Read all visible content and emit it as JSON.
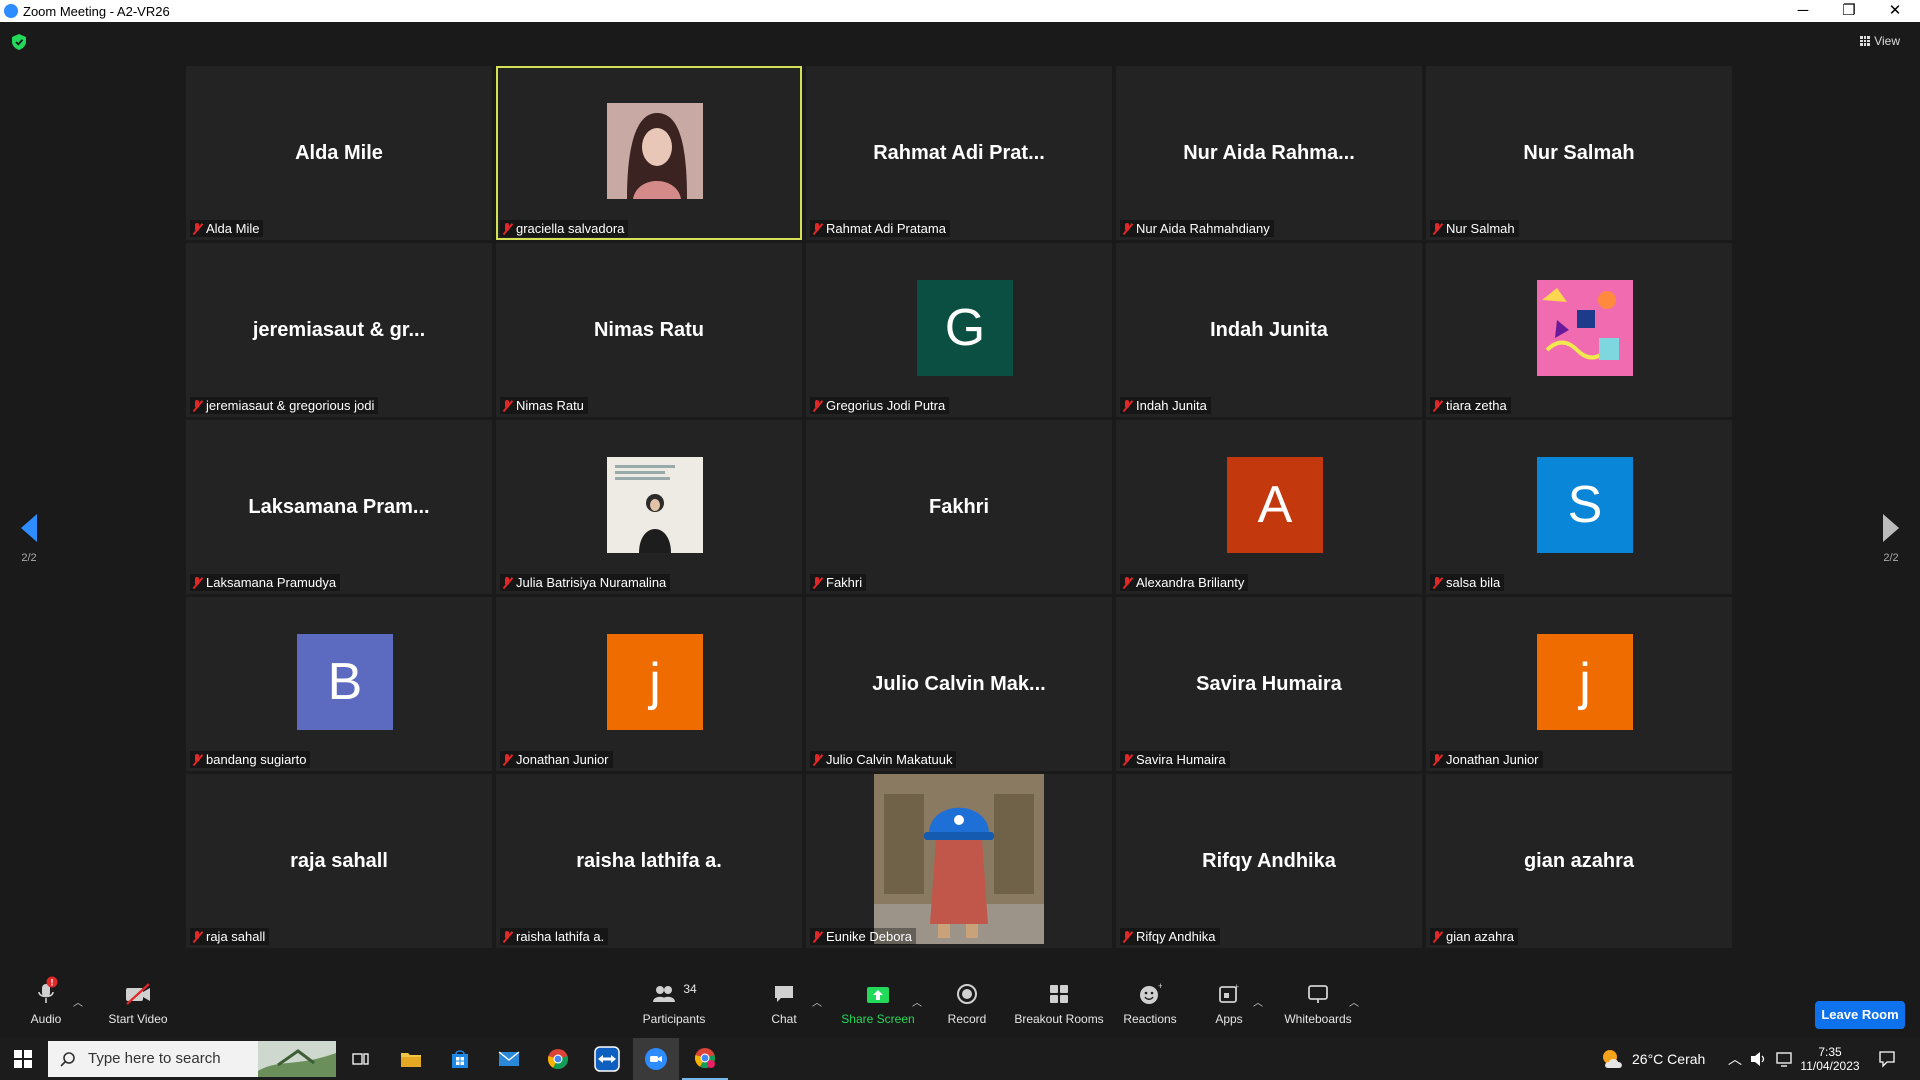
{
  "window": {
    "title": "Zoom Meeting - A2-VR26",
    "minimize": "─",
    "maximize": "❐",
    "close": "✕"
  },
  "view_label": "View",
  "pager": {
    "left": "2/2",
    "right": "2/2"
  },
  "tiles": [
    {
      "big": "Alda Mile",
      "label": "Alda Mile"
    },
    {
      "big": "",
      "label": "graciella salvadora",
      "photo": "portrait"
    },
    {
      "big": "Rahmat Adi Prat...",
      "label": "Rahmat Adi Pratama"
    },
    {
      "big": "Nur Aida Rahma...",
      "label": "Nur Aida Rahmahdiany"
    },
    {
      "big": "Nur Salmah",
      "label": "Nur Salmah"
    },
    {
      "big": "jeremiasaut & gr...",
      "label": "jeremiasaut & gregorious jodi"
    },
    {
      "big": "Nimas Ratu",
      "label": "Nimas Ratu"
    },
    {
      "big": "",
      "label": "Gregorius Jodi Putra",
      "letter": "G",
      "color": "#0b4f43"
    },
    {
      "big": "Indah Junita",
      "label": "Indah Junita"
    },
    {
      "big": "",
      "label": "tiara zetha",
      "photo": "pattern"
    },
    {
      "big": "Laksamana Pram...",
      "label": "Laksamana Pramudya"
    },
    {
      "big": "",
      "label": "Julia Batrisiya Nuramalina",
      "photo": "poster"
    },
    {
      "big": "Fakhri",
      "label": "Fakhri"
    },
    {
      "big": "",
      "label": "Alexandra Brilianty",
      "letter": "A",
      "color": "#c4380d"
    },
    {
      "big": "",
      "label": "salsa bila",
      "letter": "S",
      "color": "#0a86d9"
    },
    {
      "big": "",
      "label": "bandang sugiarto",
      "letter": "B",
      "color": "#5c6bc0"
    },
    {
      "big": "",
      "label": "Jonathan Junior",
      "letter": "j",
      "color": "#ef6c00"
    },
    {
      "big": "Julio Calvin Mak...",
      "label": "Julio Calvin Makatuuk"
    },
    {
      "big": "Savira Humaira",
      "label": "Savira Humaira"
    },
    {
      "big": "",
      "label": "Jonathan Junior",
      "letter": "j",
      "color": "#ef6c00"
    },
    {
      "big": "raja sahall",
      "label": "raja sahall"
    },
    {
      "big": "raisha lathifa a.",
      "label": "raisha lathifa a."
    },
    {
      "big": "",
      "label": "Eunike Debora",
      "photo": "character"
    },
    {
      "big": "Rifqy Andhika",
      "label": "Rifqy Andhika"
    },
    {
      "big": "gian azahra",
      "label": "gian azahra"
    }
  ],
  "toolbar": {
    "audio": "Audio",
    "audio_badge": "!",
    "start_video": "Start Video",
    "participants": "Participants",
    "participants_count": "34",
    "chat": "Chat",
    "share_screen": "Share Screen",
    "record": "Record",
    "breakout_rooms": "Breakout Rooms",
    "reactions": "Reactions",
    "apps": "Apps",
    "whiteboards": "Whiteboards",
    "leave": "Leave Room"
  },
  "colors": {
    "share_screen": "#23d959",
    "leave": "#0e72ed",
    "active_speaker": "#d4e157",
    "muted": "#e02828"
  },
  "taskbar": {
    "search_placeholder": "Type here to search",
    "weather": "26°C  Cerah",
    "time": "7:35",
    "date": "11/04/2023"
  }
}
